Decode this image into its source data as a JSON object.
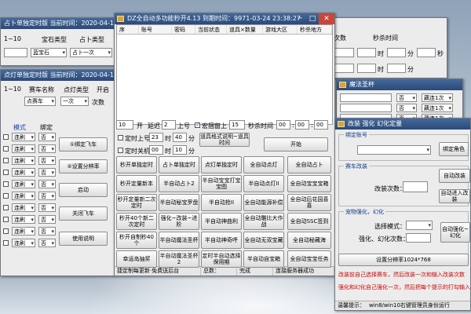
{
  "bg": {
    "w1": {
      "title": "占卜单独定时版 当前时间：2020-04-18 21:33:",
      "row1": [
        "1~10",
        "宝石类型",
        "占卜类型",
        "次数"
      ],
      "row2": [
        "蓝宝石",
        "占卜一次"
      ]
    },
    "w2": {
      "title": "点灯单独定时版 当前时间：2020-04-18 21",
      "row1": [
        "1~10",
        "赛车名称",
        "点灯类型",
        "开启"
      ],
      "row2": [
        "点赛车",
        "一次",
        "次数"
      ],
      "cols": [
        "模式",
        "绑定"
      ],
      "rows": [
        {
          "mode": "连刷",
          "bind": "否"
        },
        {
          "mode": "连刷",
          "bind": "否"
        },
        {
          "mode": "连刷",
          "bind": "否"
        },
        {
          "mode": "连刷",
          "bind": "否"
        },
        {
          "mode": "连刷",
          "bind": "否"
        },
        {
          "mode": "连刷",
          "bind": "否"
        },
        {
          "mode": "连刷",
          "bind": "否"
        },
        {
          "mode": "连刷",
          "bind": "否"
        },
        {
          "mode": "连刷",
          "bind": "否"
        },
        {
          "mode": "连刷",
          "bind": "否"
        }
      ],
      "buttons": [
        "①绑定飞车",
        "②设置分辨率",
        "启动",
        "关闭飞车",
        "使用说明"
      ]
    },
    "w3": {
      "cols": [
        "次数",
        "秒杀时间"
      ],
      "times": [
        [
          "时",
          "分",
          "秒"
        ],
        [
          "时",
          "分",
          "秒"
        ]
      ]
    },
    "w4": {
      "title": "魔法圣杯",
      "rows": [
        {
          "bind": "否",
          "mode": "藕连1次"
        },
        {
          "bind": "否",
          "mode": "藕连1次"
        },
        {
          "bind": "否",
          "mode": "藕连1次"
        }
      ]
    }
  },
  "main": {
    "title": "DZ全自动多功能秒开4.13  到期时间：9971-03-24 23:38:27",
    "columns": [
      "序",
      "账号",
      "密码",
      "当前状态",
      "道具×数量",
      "游戏大区",
      "秒杀地方"
    ],
    "row1": {
      "count": "10",
      "count_unit": "开",
      "delay_label": "延迟",
      "delay": "2",
      "up_label": "上号",
      "dock_label": "宏捆窗上",
      "dock_num": "15",
      "seckill_label": "秒杀时间",
      "t_h": "00",
      "t_m": "00",
      "t_s": "00"
    },
    "row2": {
      "timer_label": "定时上号",
      "h": "23",
      "h_unit": "时",
      "m": "40",
      "m_unit": "分",
      "btn": "道具格式说明~道具时间"
    },
    "row3": {
      "timer_label": "定时关机",
      "h": "00",
      "h_unit": "时",
      "m": "10",
      "m_unit": "分",
      "start": "开始"
    },
    "buttons": [
      [
        "秒开单独定时",
        "占卜单独定时",
        "点灯单独定时",
        "全自动点灯",
        "全自动占卜"
      ],
      [
        "秒开定量新本",
        "半自动占卜2",
        "半自动宝宝打宝宝图",
        "半自动点灯II",
        "全自动宝宝宝箱"
      ],
      [
        "秒开定量新二次定时",
        "半自动秘宝罗盘",
        "半自动抢II",
        "全自动能源补偿",
        "全自动后花园喜喜"
      ],
      [
        "秒开40个新二次定时",
        "强化~改装~进阶",
        "半自动神曲利",
        "全自动雕比大作战",
        "全自动SSC签到"
      ],
      [
        "秒开自制秒40个",
        "半自动魔法圣杯",
        "半自动神奇呼",
        "全自动无双宝藏",
        "全自动秘藏海"
      ],
      [
        "幸运岛抽奖",
        "半自动魔法圣杯2",
        "定时半自动选择保用期",
        "半自动自宝箱",
        "全自动宝宝任务"
      ]
    ],
    "status": [
      "捷定制每更新·免费送后台",
      "总数：",
      "完成",
      "连接服务器成功"
    ]
  },
  "side": {
    "title": "改装 强化 幻化定量",
    "bind_group": "绑定账号",
    "bind_btn": "绑定角色",
    "mod_group": "赛车改装",
    "mod_count_label": "改装次数：",
    "auto_mod_btn": "自动改装",
    "auto_enter_btn": "自动进入改装",
    "enh_group": "宠物强化，幻化",
    "select_mode_label": "选择模式：",
    "enh_count_label": "强化、幻化次数：",
    "auto_enh_btn": "自动强化~幻化",
    "resolution_btn": "设置分辨率1024*768",
    "note1": "改装前自己选择赛车，然后改装一次和输入改装次数",
    "note2": "强化和幻化自己强化一次，然后把每个提示的打勾输入",
    "tip_label": "温馨提示：",
    "tip": "win8/win10右键管理员身份运行"
  }
}
